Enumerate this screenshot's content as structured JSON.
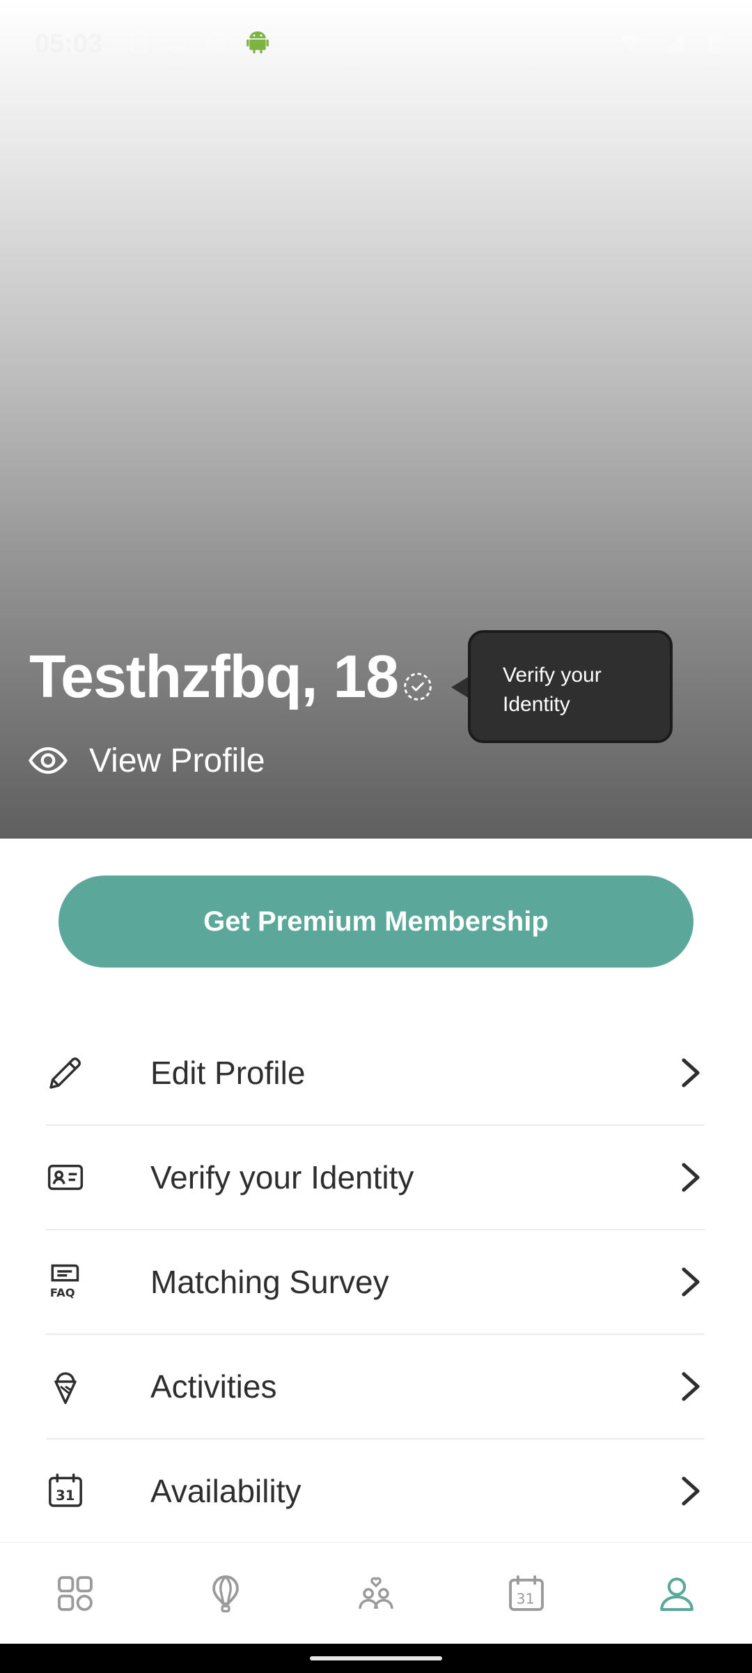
{
  "status_bar": {
    "time": "05:03"
  },
  "profile": {
    "name_age": "Testhzfbq, 18",
    "view_profile_label": "View Profile",
    "tooltip_text": "Verify your Identity"
  },
  "premium": {
    "label": "Get Premium Membership",
    "color": "#5ba89b"
  },
  "menu": {
    "items": [
      {
        "label": "Edit Profile",
        "icon": "pencil-icon"
      },
      {
        "label": "Verify your Identity",
        "icon": "id-card-icon"
      },
      {
        "label": "Matching Survey",
        "icon": "faq-icon"
      },
      {
        "label": "Activities",
        "icon": "ice-cream-icon"
      },
      {
        "label": "Availability",
        "icon": "calendar-icon"
      }
    ]
  },
  "bottom_nav": {
    "items": [
      {
        "name": "grid-icon",
        "active": false
      },
      {
        "name": "balloon-icon",
        "active": false
      },
      {
        "name": "matches-icon",
        "active": false
      },
      {
        "name": "calendar-icon",
        "active": false
      },
      {
        "name": "profile-icon",
        "active": true
      }
    ],
    "active_color": "#5ba89b",
    "inactive_color": "#9a9a9a"
  }
}
